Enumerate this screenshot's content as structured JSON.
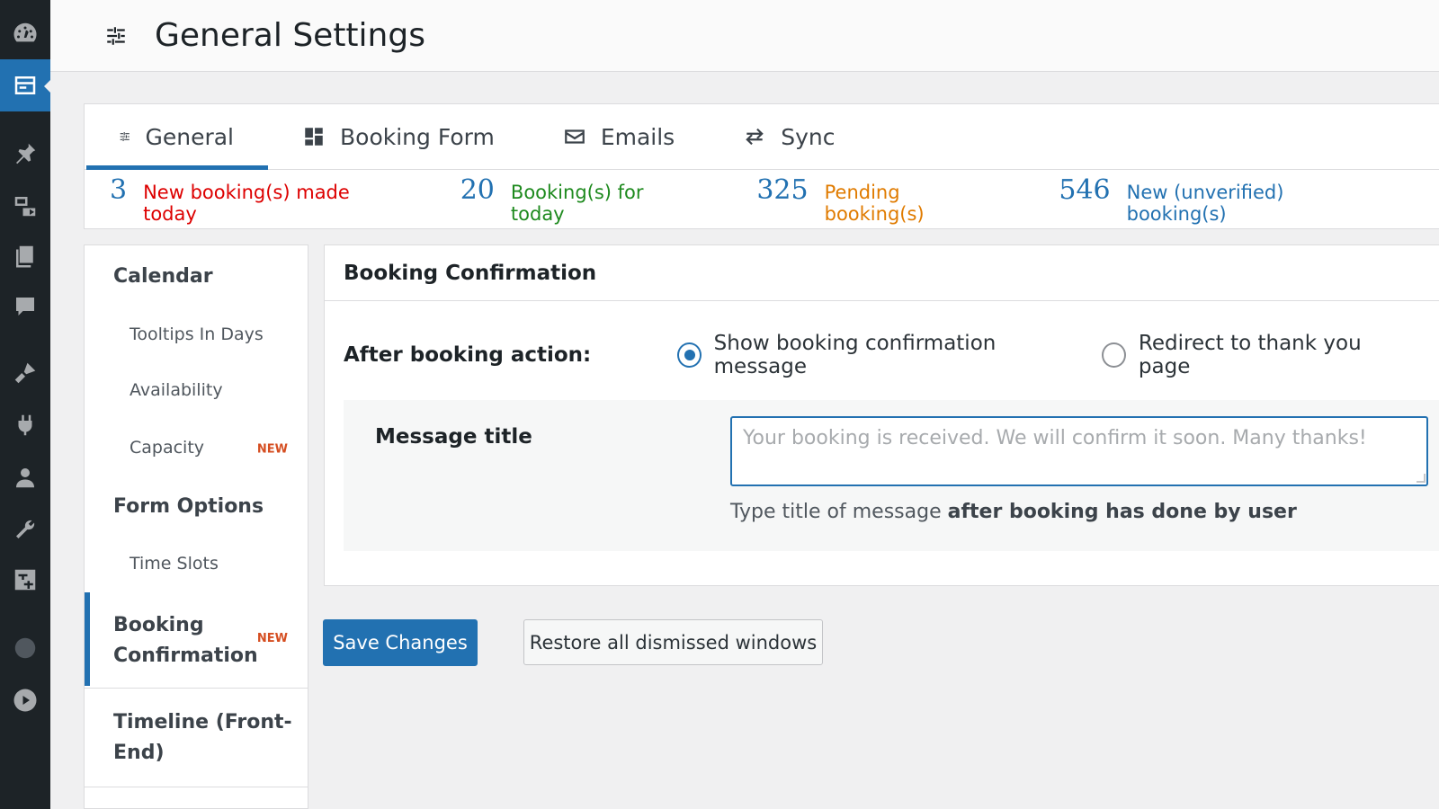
{
  "header": {
    "title": "General Settings",
    "icon": "sliders-icon"
  },
  "admin_menu": [
    {
      "name": "dashboard-icon"
    },
    {
      "name": "booking-calendar-icon",
      "active": true
    },
    {
      "name": "pin-icon"
    },
    {
      "name": "media-icon"
    },
    {
      "name": "pages-icon"
    },
    {
      "name": "comments-icon"
    },
    {
      "name": "appearance-icon"
    },
    {
      "name": "plugins-icon"
    },
    {
      "name": "users-icon"
    },
    {
      "name": "tools-icon"
    },
    {
      "name": "settings-icon"
    },
    {
      "name": "globe-icon"
    },
    {
      "name": "play-icon"
    }
  ],
  "tabs": [
    {
      "label": "General",
      "icon": "sliders-icon",
      "active": true
    },
    {
      "label": "Booking Form",
      "icon": "grid-icon"
    },
    {
      "label": "Emails",
      "icon": "envelope-icon"
    },
    {
      "label": "Sync",
      "icon": "arrows-icon"
    }
  ],
  "stats": [
    {
      "value": "3",
      "label": "New booking(s) made today",
      "color": "#dd0000"
    },
    {
      "value": "20",
      "label": "Booking(s) for today",
      "color": "#1e8a1e"
    },
    {
      "value": "325",
      "label": "Pending booking(s)",
      "color": "#e07b00"
    },
    {
      "value": "546",
      "label": "New (unverified) booking(s)",
      "color": "#2271b1"
    }
  ],
  "nav": {
    "calendar": "Calendar",
    "tooltips": "Tooltips In Days",
    "availability": "Availability",
    "capacity": "Capacity",
    "capacity_badge": "NEW",
    "form_options": "Form Options",
    "time_slots": "Time Slots",
    "booking_line1": "Booking",
    "booking_line2": "Confirmation",
    "booking_badge": "NEW",
    "timeline_line1": "Timeline (Front-",
    "timeline_line2": "End)"
  },
  "panel": {
    "title": "Booking Confirmation",
    "after_action_label": "After booking action:",
    "radio_show": "Show booking confirmation message",
    "radio_redirect": "Redirect to thank you page",
    "message_title_label": "Message title",
    "message_placeholder": "Your booking is received. We will confirm it soon. Many thanks!",
    "help_prefix": "Type title of message ",
    "help_bold": "after booking has done by user"
  },
  "buttons": {
    "save": "Save Changes",
    "restore": "Restore all dismissed windows"
  },
  "colors": {
    "accent": "#2271b1",
    "badge": "#d54e21"
  }
}
